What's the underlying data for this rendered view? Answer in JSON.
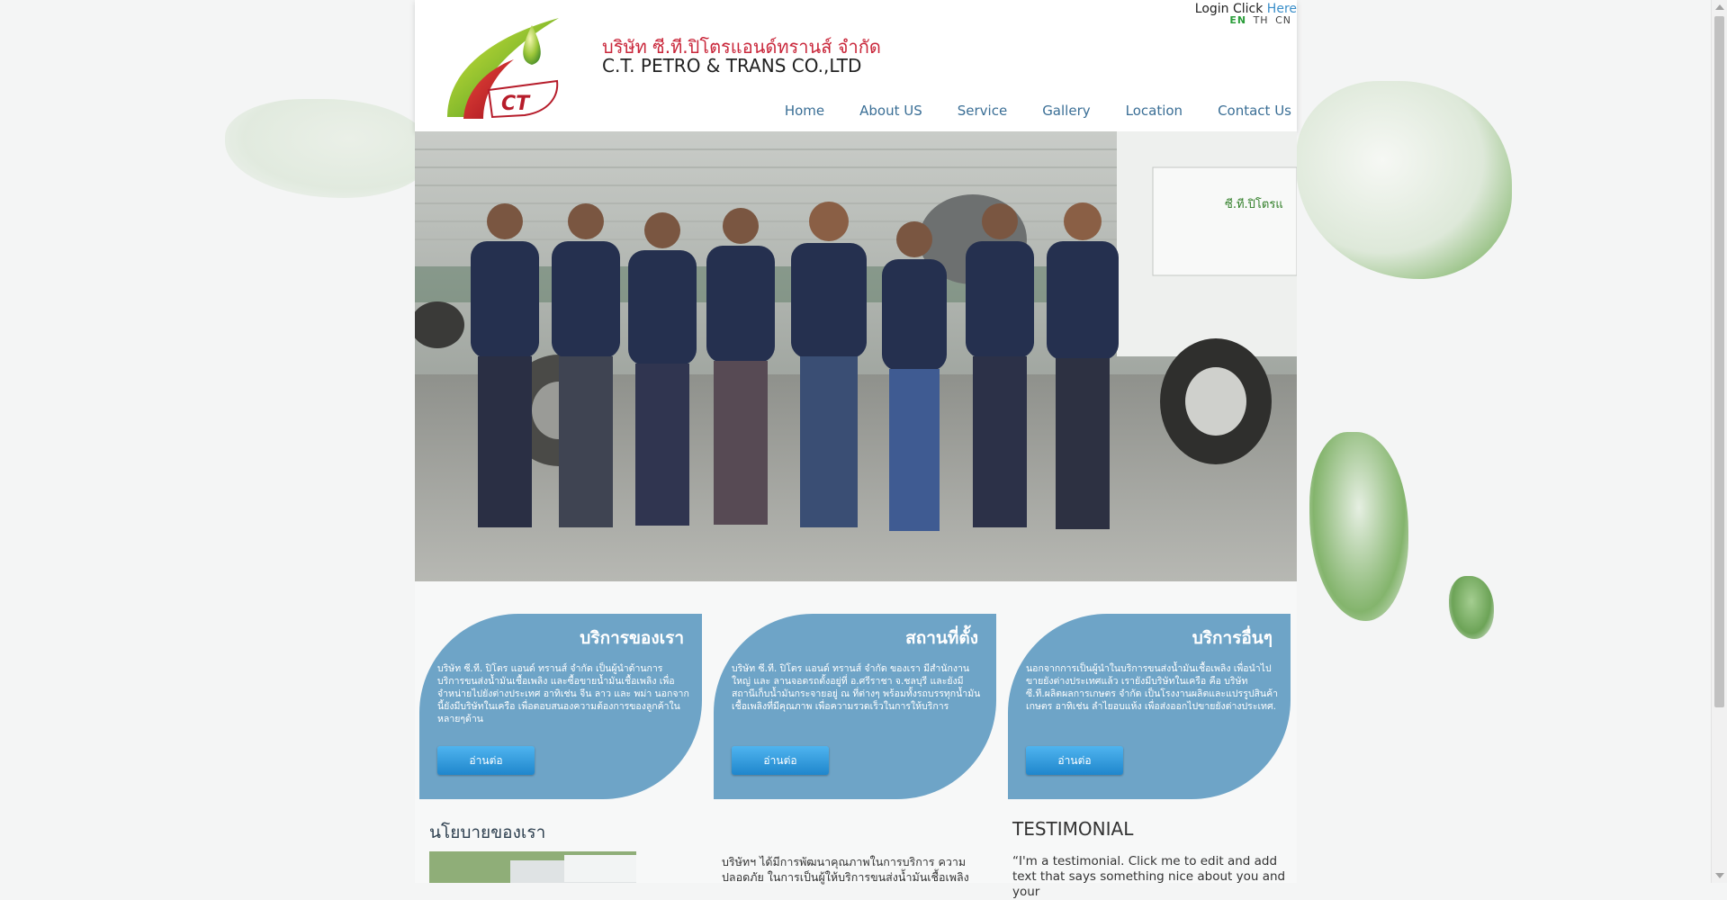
{
  "header": {
    "login_prefix": "Login Click",
    "login_link": "Here",
    "languages": [
      "EN",
      "TH",
      "CN"
    ],
    "company_name_th": "บริษัท ซี.ที.ปิโตรแอนด์ทรานส์ จำกัด",
    "company_name_en": "C.T. PETRO & TRANS CO.,LTD",
    "logo_text": "CT"
  },
  "nav": {
    "items": [
      "Home",
      "About US",
      "Service",
      "Gallery",
      "Location",
      "Contact Us"
    ]
  },
  "hero": {
    "truck_text": "ซี.ที.ปิโตรแ"
  },
  "cards": [
    {
      "title": "บริการของเรา",
      "text": "บริษัท ซี.ที. ปิโตร แอนด์ ทรานส์ จำกัด เป็นผู้นำด้านการบริการขนส่งน้ำมันเชื้อเพลิง และซื้อขายน้ำมันเชื้อเพลิง เพื่อจำหน่ายไปยังต่างประเทศ อาทิเช่น จีน ลาว และ พม่า นอกจากนี้ยังมีบริษัทในเครือ เพื่อตอบสนองความต้องการของลูกค้าในหลายๆด้าน",
      "button": "อ่านต่อ"
    },
    {
      "title": "สถานที่ตั้ง",
      "text": "บริษัท ซี.ที. ปิโตร แอนด์ ทรานส์ จำกัด ของเรา มีสำนักงานใหญ่ และ ลานจอดรถตั้งอยู่ที่ อ.ศรีราชา จ.ชลบุรี และยังมีสถานีเก็บน้ำมันกระจายอยู่ ณ ที่ต่างๆ พร้อมทั้งรถบรรทุกน้ำมันเชื้อเพลิงที่มีคุณภาพ เพื่อความรวดเร็วในการให้บริการ",
      "button": "อ่านต่อ"
    },
    {
      "title": "บริการอื่นๆ",
      "text": "นอกจากการเป็นผู้นำในบริการขนส่งน้ำมันเชื้อเพลิง เพื่อนำไปขายยังต่างประเทศแล้ว เรายังมีบริษัทในเครือ คือ บริษัท ซี.ที.ผลิตผลการเกษตร จำกัด เป็นโรงงานผลิตและแปรรูปสินค้าเกษตร อาทิเช่น ลำไยอบแห้ง เพื่อส่งออกไปขายยังต่างประเทศ.",
      "button": "อ่านต่อ"
    }
  ],
  "policy": {
    "title": "นโยบายของเรา",
    "text": "บริษัทฯ ได้มีการพัฒนาคุณภาพในการบริการ ความปลอดภัย ในการเป็นผู้ให้บริการขนส่งน้ำมันเชื้อเพลิง"
  },
  "testimonial": {
    "title": "TESTIMONIAL",
    "text": "“I'm a testimonial. Click me to edit and add text that says something nice about you and your"
  }
}
